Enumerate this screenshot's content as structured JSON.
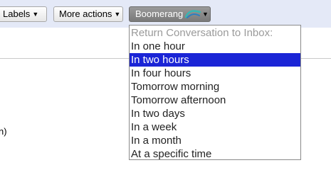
{
  "toolbar": {
    "labels_label": "Labels",
    "more_actions_label": "More actions",
    "boomerang_label": "Boomerang",
    "caret": "▼"
  },
  "content": {
    "partial_text": "n)"
  },
  "boomerang_menu": {
    "header": "Return Conversation to Inbox:",
    "items": [
      "In one hour",
      "In two hours",
      "In four hours",
      "Tomorrow morning",
      "Tomorrow afternoon",
      "In two days",
      "In a week",
      "In a month",
      "At a specific time"
    ],
    "selected": "In two hours"
  },
  "colors": {
    "toolbar_bg": "#e4e9f7",
    "selection_bg": "#1b25d6",
    "boomerang_button_bg": "#8a8a8a"
  },
  "icons": [
    "dropdown-caret-icon",
    "boomerang-logo-icon"
  ]
}
